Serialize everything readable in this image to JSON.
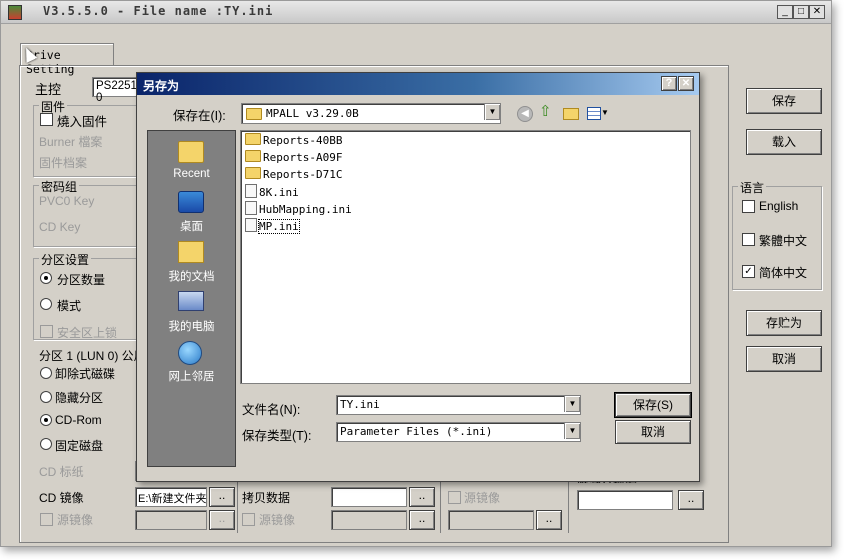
{
  "app": {
    "title": "V3.5.5.0 - File name :TY.ini",
    "min_icon": "minimize-icon",
    "max_icon": "maximize-icon",
    "close_icon": "close-icon"
  },
  "tabs": [
    {
      "label": "Drive Setting"
    }
  ],
  "main": {
    "controller_label": "主控",
    "controller_value": "PS2251-0",
    "firmware": {
      "title": "固件",
      "burn_fw_label": "燒入固件",
      "burner_file_label": "Burner 檔案",
      "fw_file_label": "固件档案"
    },
    "password": {
      "title": "密码组",
      "pvc0_label": "PVC0 Key",
      "cd_key_label": "CD Key"
    },
    "partition": {
      "title": "分区设置",
      "count_label": "分区数量",
      "mode_label": "模式",
      "secure_lock_label": "安全区上锁",
      "partition1_title": "分区 1 (LUN 0) 公用",
      "removable_label": "卸除式磁碟",
      "hidden_label": "隐藏分区",
      "cdrom_label": "CD-Rom",
      "fixed_label": "固定磁盘",
      "cd_label_label": "CD 标纸",
      "cd_image_label": "CD 镜像",
      "cd_image_value": "E:\\新建文件夹",
      "source_image_label": "源镜像",
      "copy_data_label": "拷贝数据",
      "source_image_label2": "源镜像",
      "source_image_label3": "源镜像",
      "hidden_file_label": "隐藏分档案",
      "browse_label": ".."
    }
  },
  "right_panel": {
    "save_label": "保存",
    "load_label": "载入",
    "language_title": "语言",
    "languages": [
      {
        "label": "English",
        "checked": false
      },
      {
        "label": "繁體中文",
        "checked": false
      },
      {
        "label": "简体中文",
        "checked": true
      }
    ],
    "save_as_label": "存贮为",
    "cancel_label": "取消"
  },
  "dialog": {
    "title": "另存为",
    "help_label": "?",
    "close_label": "✕",
    "save_in_label": "保存在(I):",
    "folder_value": "MPALL v3.29.0B",
    "places": [
      {
        "label": "Recent",
        "icon": "recent-icon"
      },
      {
        "label": "桌面",
        "icon": "desktop-icon"
      },
      {
        "label": "我的文档",
        "icon": "my-documents-icon"
      },
      {
        "label": "我的电脑",
        "icon": "my-computer-icon"
      },
      {
        "label": "网上邻居",
        "icon": "network-places-icon"
      }
    ],
    "files": [
      {
        "name": "Reports-40BB",
        "type": "folder"
      },
      {
        "name": "Reports-A09F",
        "type": "folder"
      },
      {
        "name": "Reports-D71C",
        "type": "folder"
      },
      {
        "name": "8K.ini",
        "type": "ini"
      },
      {
        "name": "HubMapping.ini",
        "type": "ini"
      },
      {
        "name": "MP.ini",
        "type": "ini",
        "selected": true
      }
    ],
    "filename_label": "文件名(N):",
    "filename_value": "TY.ini",
    "filetype_label": "保存类型(T):",
    "filetype_value": "Parameter Files (*.ini)",
    "save_button": "保存(S)",
    "cancel_button": "取消"
  }
}
